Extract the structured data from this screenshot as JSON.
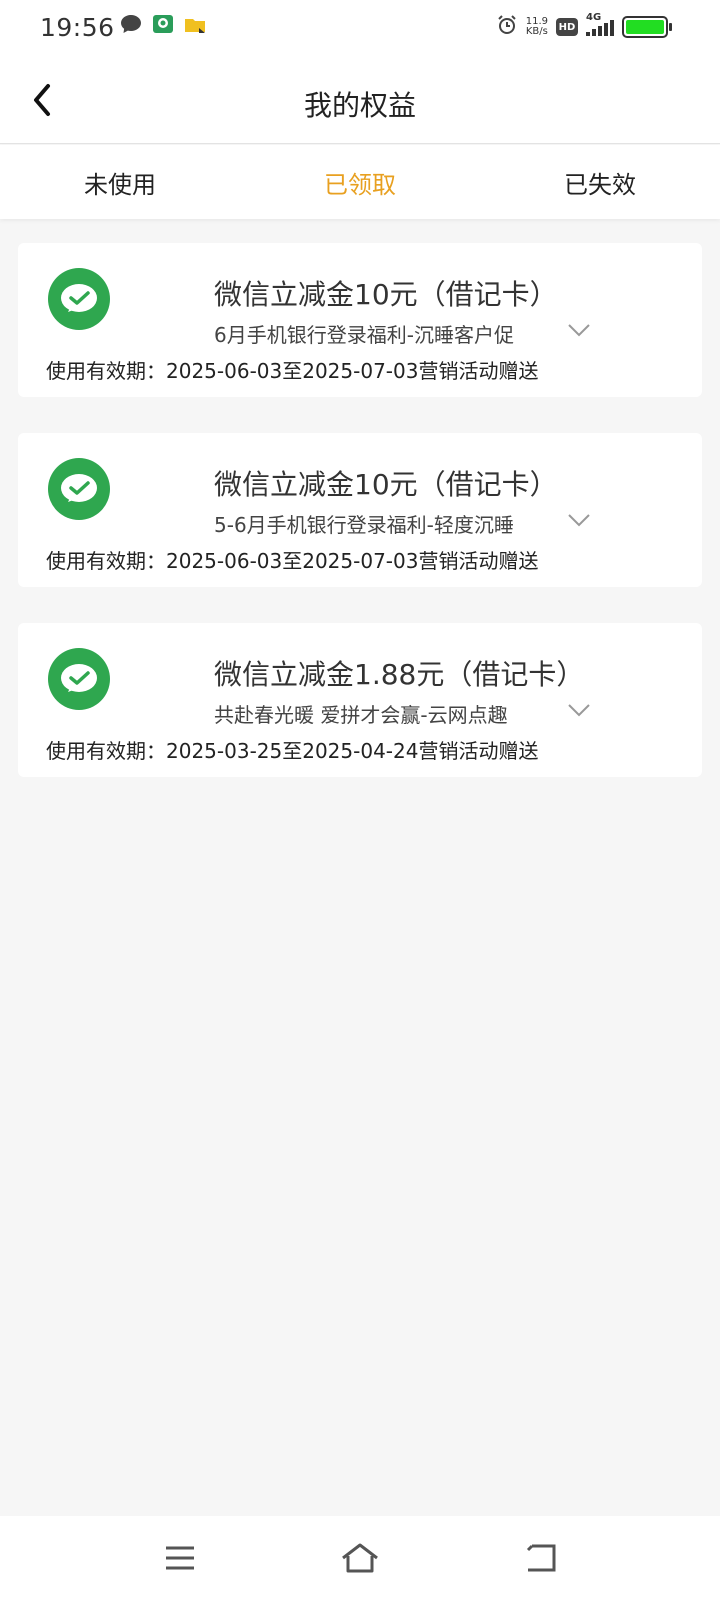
{
  "status_bar": {
    "time": "19:56",
    "net_speed_value": "11.9",
    "net_speed_unit": "KB/s",
    "hd_label": "HD",
    "network_label": "4G",
    "battery_color": "#22dd22"
  },
  "header": {
    "title": "我的权益",
    "back_icon": "chevron-left-icon"
  },
  "tabs": [
    {
      "label": "未使用",
      "active": false
    },
    {
      "label": "已领取",
      "active": true
    },
    {
      "label": "已失效",
      "active": false
    }
  ],
  "accent_color": "#e8a020",
  "coupons": [
    {
      "title": "微信立减金10元（借记卡）",
      "subtitle": "6月手机银行登录福利-沉睡客户促",
      "validity": "使用有效期：2025-06-03至2025-07-03营销活动赠送",
      "icon": "wechat-pay-icon"
    },
    {
      "title": "微信立减金10元（借记卡）",
      "subtitle": "5-6月手机银行登录福利-轻度沉睡",
      "validity": "使用有效期：2025-06-03至2025-07-03营销活动赠送",
      "icon": "wechat-pay-icon"
    },
    {
      "title": "微信立减金1.88元（借记卡）",
      "subtitle": "共赴春光暖 爱拼才会赢-云网点趣",
      "validity": "使用有效期：2025-03-25至2025-04-24营销活动赠送",
      "icon": "wechat-pay-icon"
    }
  ],
  "coupon_icon_color": "#2fa74f",
  "bottom_nav": {
    "menu_icon": "menu-icon",
    "home_icon": "home-icon",
    "back_icon": "back-icon"
  }
}
